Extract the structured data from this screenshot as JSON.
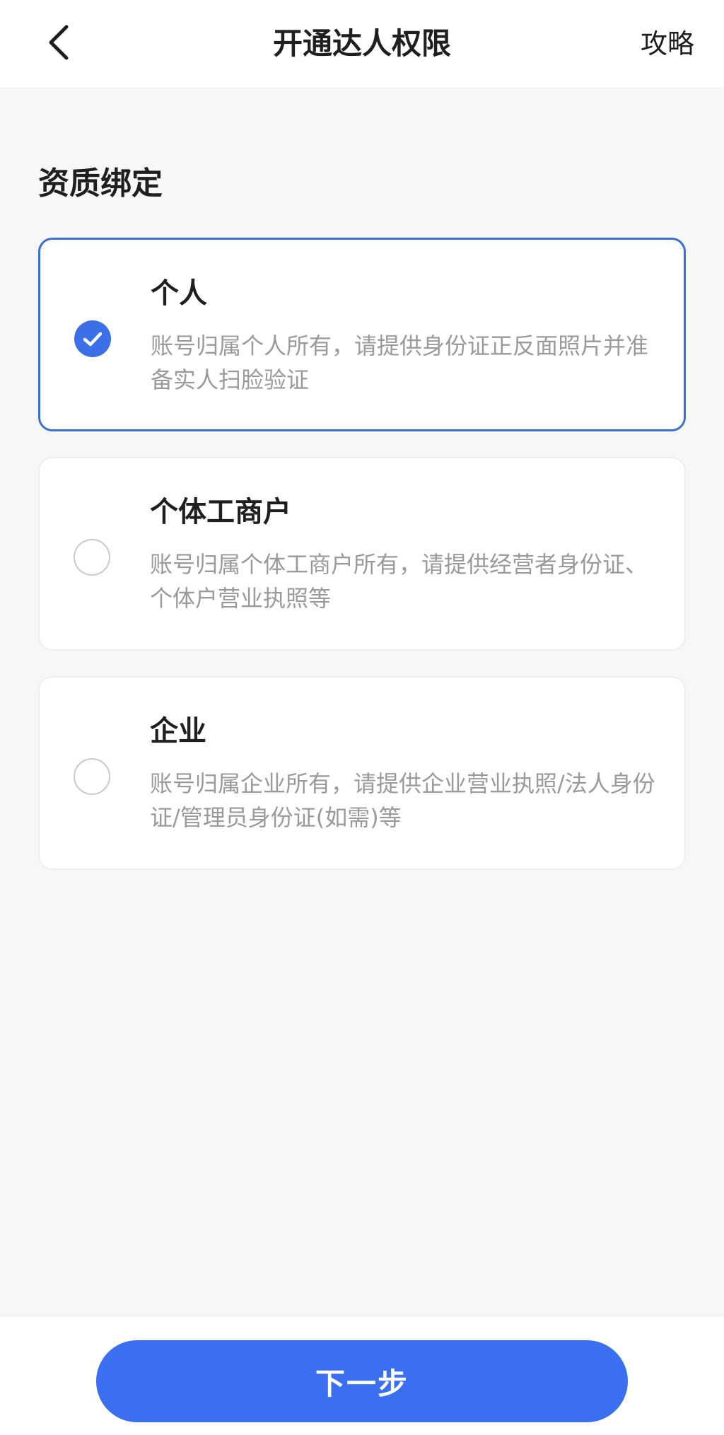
{
  "header": {
    "title": "开通达人权限",
    "guide_label": "攻略",
    "back_icon": "chevron-left-icon"
  },
  "section": {
    "title": "资质绑定"
  },
  "options": [
    {
      "title": "个人",
      "description": "账号归属个人所有，请提供身份证正反面照片并准备实人扫脸验证",
      "selected": true
    },
    {
      "title": "个体工商户",
      "description": "账号归属个体工商户所有，请提供经营者身份证、个体户营业执照等",
      "selected": false
    },
    {
      "title": "企业",
      "description": "账号归属企业所有，请提供企业营业执照/法人身份证/管理员身份证(如需)等",
      "selected": false
    }
  ],
  "footer": {
    "next_label": "下一步"
  },
  "colors": {
    "accent": "#3b6ff2",
    "selected_border": "#3a6fcf",
    "muted_text": "#9a9a9a"
  }
}
